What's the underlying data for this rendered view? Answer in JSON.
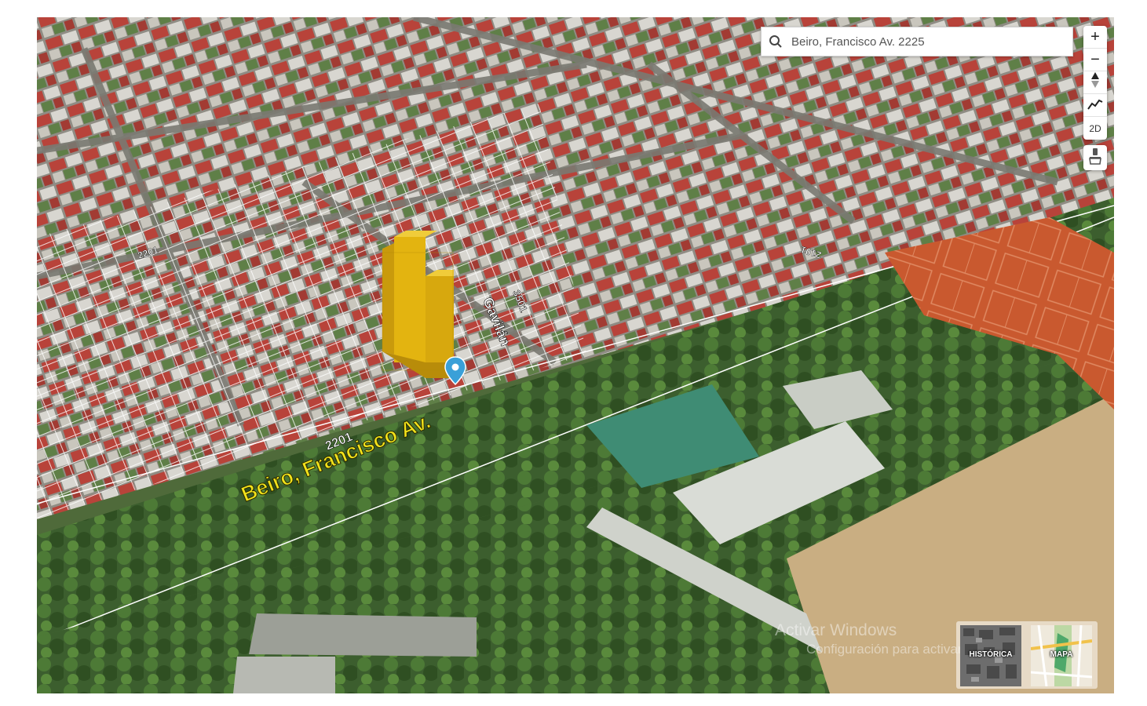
{
  "search": {
    "value": "Beiro, Francisco Av. 2225",
    "placeholder": "Beiro, Francisco Av. 2225"
  },
  "controls": {
    "zoom_in_label": "+",
    "zoom_out_label": "−",
    "view_2d_label": "2D"
  },
  "map": {
    "street_main_label": "Beiro, Francisco Av.",
    "street_main_number": "2201",
    "street_cross_label": "Gavilán",
    "street_cross_number": "3501",
    "block_number_left": "2201",
    "block_number_right": "2101"
  },
  "layers": {
    "historic_label": "HISTÓRICA",
    "map_label": "MAPA"
  },
  "watermark": {
    "line1": "Activar Windows",
    "line2": "Configuración para activar Windows"
  },
  "colors": {
    "building": "#e3b410",
    "marker": "#3aa0d8",
    "street_label": "#f2e21b"
  },
  "icons": [
    "search-icon",
    "north-arrow-icon",
    "elevation-profile-icon",
    "eraser-icon",
    "location-pin-icon"
  ]
}
